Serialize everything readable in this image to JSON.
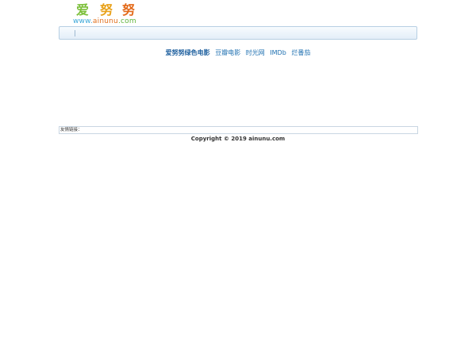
{
  "logo": {
    "chars": [
      "爱",
      "努",
      "努"
    ],
    "url_parts": [
      "www.",
      "ainunu",
      ".com"
    ]
  },
  "navbar": {
    "items": []
  },
  "categories": {
    "items": [
      {
        "label": "爱努努绿色电影",
        "active": true
      },
      {
        "label": "豆瓣电影",
        "active": false
      },
      {
        "label": "时光网",
        "active": false
      },
      {
        "label": "IMDb",
        "active": false
      },
      {
        "label": "烂番茄",
        "active": false
      }
    ]
  },
  "friend_links": {
    "label": "友情链接："
  },
  "footer": {
    "copyright": "Copyright © 2019 ainunu.com"
  }
}
